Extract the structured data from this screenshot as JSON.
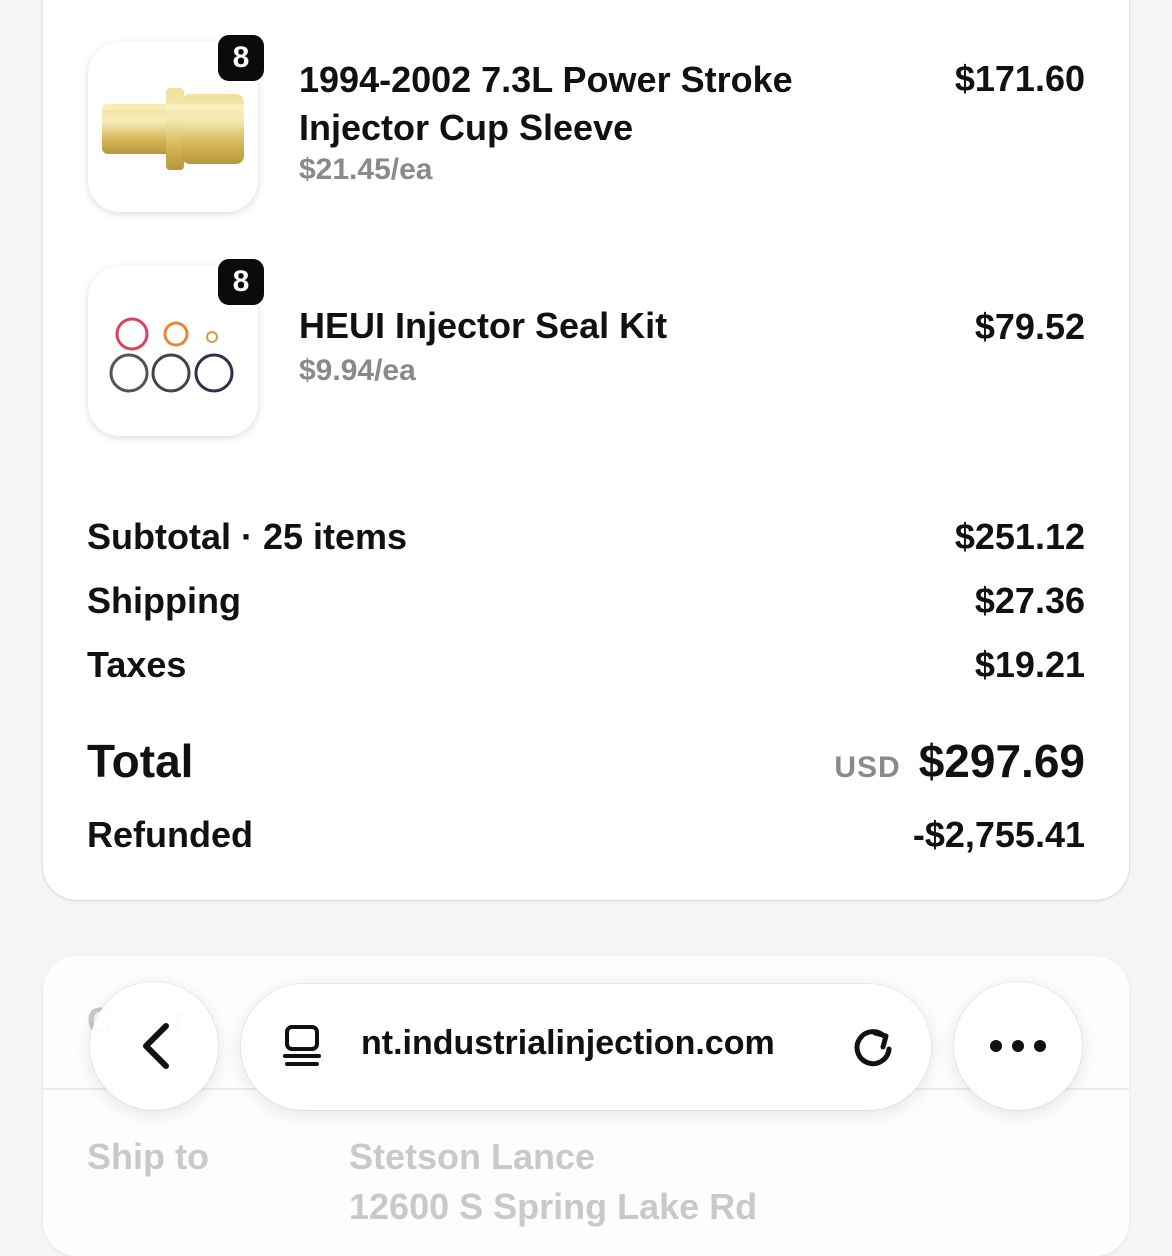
{
  "items": [
    {
      "qty": "8",
      "name": "1994-2002 7.3L Power Stroke Injector Cup Sleeve",
      "unit_price": "$21.45/ea",
      "price": "$171.60",
      "image_icon": "brass-sleeve-icon"
    },
    {
      "qty": "8",
      "name": "HEUI Injector Seal Kit",
      "unit_price": "$9.94/ea",
      "price": "$79.52",
      "image_icon": "o-ring-kit-icon"
    }
  ],
  "summary": {
    "subtotal_label": "Subtotal · 25 items",
    "subtotal": "$251.12",
    "shipping_label": "Shipping",
    "shipping": "$27.36",
    "taxes_label": "Taxes",
    "taxes": "$19.21",
    "total_label": "Total",
    "currency": "USD",
    "total": "$297.69",
    "refunded_label": "Refunded",
    "refunded": "-$2,755.41"
  },
  "details": {
    "contact_label_partial": "C      t",
    "ship_to_label": "Ship to",
    "ship_to_name": "Stetson Lance",
    "ship_to_line_partial": "12600 S Spring Lake Rd"
  },
  "browser": {
    "url": "nt.industrialinjection.com",
    "back_icon": "chevron-left-icon",
    "tabs_icon": "tab-overview-icon",
    "reload_icon": "reload-icon",
    "more_icon": "more-dots-icon"
  }
}
